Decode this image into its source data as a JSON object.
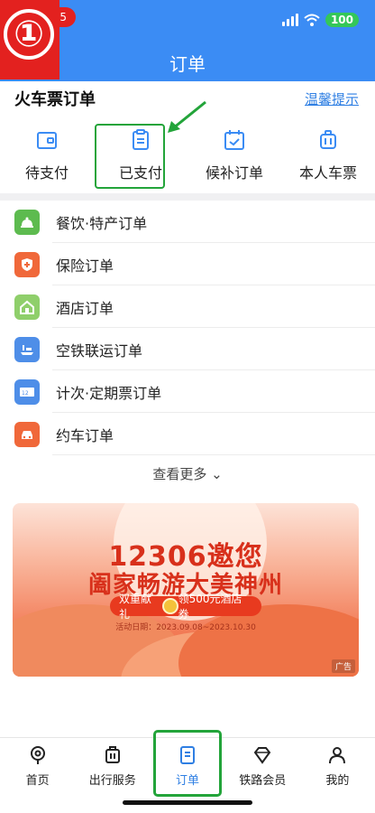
{
  "status": {
    "battery": "100"
  },
  "badge": {
    "step": "①",
    "notification": "5"
  },
  "header": {
    "title": "订单"
  },
  "train": {
    "title": "火车票订单",
    "tip": "温馨提示",
    "items": [
      {
        "label": "待支付",
        "icon": "wallet-icon"
      },
      {
        "label": "已支付",
        "icon": "clipboard-icon"
      },
      {
        "label": "候补订单",
        "icon": "calendar-icon"
      },
      {
        "label": "本人车票",
        "icon": "luggage-icon"
      }
    ]
  },
  "orders": [
    {
      "label": "餐饮·特产订单",
      "icon": "food-cloche-icon",
      "color": "#5dbb4f"
    },
    {
      "label": "保险订单",
      "icon": "shield-icon",
      "color": "#f0683a"
    },
    {
      "label": "酒店订单",
      "icon": "hotel-icon",
      "color": "#8fcf6b"
    },
    {
      "label": "空铁联运订单",
      "icon": "plane-train-icon",
      "color": "#4e8ee8"
    },
    {
      "label": "计次·定期票订单",
      "icon": "ticket-icon",
      "color": "#4e8ee8"
    },
    {
      "label": "约车订单",
      "icon": "car-icon",
      "color": "#f0683a"
    }
  ],
  "more": "查看更多 ⌄",
  "banner": {
    "title1": "12306邀您",
    "title2": "阖家畅游大美神州",
    "pill_left": "双重献礼",
    "pill_right": "领500元酒店券",
    "date": "活动日期：2023.09.08~2023.10.30",
    "ad": "广告"
  },
  "tabs": [
    {
      "label": "首页",
      "icon": "home-icon"
    },
    {
      "label": "出行服务",
      "icon": "suitcase-icon"
    },
    {
      "label": "订单",
      "icon": "order-icon"
    },
    {
      "label": "铁路会员",
      "icon": "diamond-icon"
    },
    {
      "label": "我的",
      "icon": "profile-icon"
    }
  ],
  "colors": {
    "primary": "#3b8cf4",
    "highlight": "#23a43a",
    "badge": "#e3211f"
  }
}
